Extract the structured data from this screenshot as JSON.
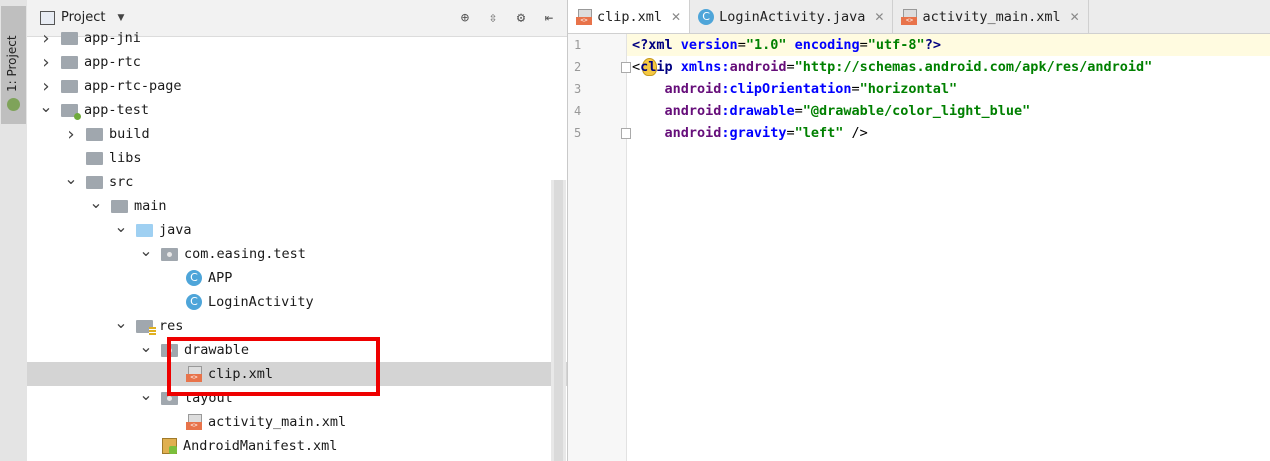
{
  "side_stripe": {
    "label": "1: Project"
  },
  "project_panel": {
    "title": "Project",
    "tree": [
      {
        "label": "app-jni",
        "depth": 1,
        "arrow": "right",
        "icon": "folder"
      },
      {
        "label": "app-rtc",
        "depth": 1,
        "arrow": "right",
        "icon": "folder"
      },
      {
        "label": "app-rtc-page",
        "depth": 1,
        "arrow": "right",
        "icon": "folder"
      },
      {
        "label": "app-test",
        "depth": 1,
        "arrow": "down",
        "icon": "folder-module"
      },
      {
        "label": "build",
        "depth": 2,
        "arrow": "right",
        "icon": "folder"
      },
      {
        "label": "libs",
        "depth": 2,
        "arrow": "none",
        "icon": "folder"
      },
      {
        "label": "src",
        "depth": 2,
        "arrow": "down",
        "icon": "folder"
      },
      {
        "label": "main",
        "depth": 3,
        "arrow": "down",
        "icon": "folder"
      },
      {
        "label": "java",
        "depth": 4,
        "arrow": "down",
        "icon": "folder-blue"
      },
      {
        "label": "com.easing.test",
        "depth": 5,
        "arrow": "down",
        "icon": "folder-package"
      },
      {
        "label": "APP",
        "depth": 6,
        "arrow": "none",
        "icon": "class"
      },
      {
        "label": "LoginActivity",
        "depth": 6,
        "arrow": "none",
        "icon": "class"
      },
      {
        "label": "res",
        "depth": 4,
        "arrow": "down",
        "icon": "folder-res"
      },
      {
        "label": "drawable",
        "depth": 5,
        "arrow": "down",
        "icon": "folder-package"
      },
      {
        "label": "clip.xml",
        "depth": 6,
        "arrow": "none",
        "icon": "xml",
        "selected": true
      },
      {
        "label": "layout",
        "depth": 5,
        "arrow": "down",
        "icon": "folder-package"
      },
      {
        "label": "activity_main.xml",
        "depth": 6,
        "arrow": "none",
        "icon": "xml"
      },
      {
        "label": "AndroidManifest.xml",
        "depth": 5,
        "arrow": "none",
        "icon": "manifest"
      }
    ]
  },
  "editor": {
    "tabs": [
      {
        "label": "clip.xml",
        "icon": "xml",
        "active": true
      },
      {
        "label": "LoginActivity.java",
        "icon": "class",
        "active": false
      },
      {
        "label": "activity_main.xml",
        "icon": "xml",
        "active": false
      }
    ],
    "line_numbers": [
      "1",
      "2",
      "3",
      "4",
      "5"
    ],
    "lines": [
      [
        {
          "t": "<?xml ",
          "c": "t-tag"
        },
        {
          "t": "version",
          "c": "t-attr"
        },
        {
          "t": "=",
          "c": "t-plain"
        },
        {
          "t": "\"1.0\" ",
          "c": "t-val"
        },
        {
          "t": "encoding",
          "c": "t-attr"
        },
        {
          "t": "=",
          "c": "t-plain"
        },
        {
          "t": "\"utf-8\"",
          "c": "t-val"
        },
        {
          "t": "?>",
          "c": "t-tag"
        }
      ],
      [
        {
          "t": "<",
          "c": "t-plain"
        },
        {
          "t": "clip ",
          "c": "t-tag"
        },
        {
          "t": "xmlns:",
          "c": "t-attr"
        },
        {
          "t": "android",
          "c": "t-ns"
        },
        {
          "t": "=",
          "c": "t-plain"
        },
        {
          "t": "\"http://schemas.android.com/apk/res/android\"",
          "c": "t-val"
        }
      ],
      [
        {
          "t": "    ",
          "c": "t-plain"
        },
        {
          "t": "android",
          "c": "t-ns"
        },
        {
          "t": ":clipOrientation",
          "c": "t-attr"
        },
        {
          "t": "=",
          "c": "t-plain"
        },
        {
          "t": "\"horizontal\"",
          "c": "t-val"
        }
      ],
      [
        {
          "t": "    ",
          "c": "t-plain"
        },
        {
          "t": "android",
          "c": "t-ns"
        },
        {
          "t": ":drawable",
          "c": "t-attr"
        },
        {
          "t": "=",
          "c": "t-plain"
        },
        {
          "t": "\"@drawable/color_light_blue\"",
          "c": "t-val"
        }
      ],
      [
        {
          "t": "    ",
          "c": "t-plain"
        },
        {
          "t": "android",
          "c": "t-ns"
        },
        {
          "t": ":gravity",
          "c": "t-attr"
        },
        {
          "t": "=",
          "c": "t-plain"
        },
        {
          "t": "\"left\" ",
          "c": "t-val"
        },
        {
          "t": "/>",
          "c": "t-plain"
        }
      ]
    ]
  }
}
